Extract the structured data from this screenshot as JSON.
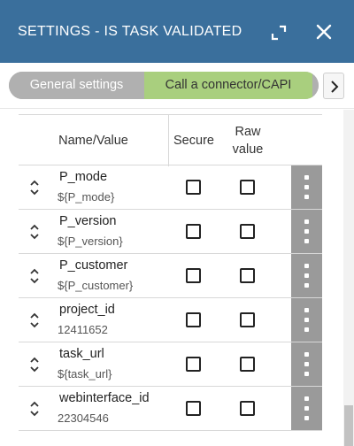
{
  "header": {
    "title": "SETTINGS  - IS TASK VALIDATED",
    "background": "#3a6f9c",
    "expand_icon": "expand-icon",
    "close_icon": "close-icon"
  },
  "tabs": {
    "items": [
      {
        "label": "General settings",
        "active": false
      },
      {
        "label": "Call a connector/CAPI",
        "active": true
      }
    ],
    "next_icon": "chevron-right-icon",
    "active_color": "#a9cf7e",
    "inactive_color": "#b0b0b0"
  },
  "table": {
    "headers": {
      "name_value": "Name/Value",
      "secure": "Secure",
      "raw_value": "Raw\nvalue"
    },
    "rows": [
      {
        "name": "P_mode",
        "value": "${P_mode}",
        "secure": false,
        "raw": false
      },
      {
        "name": "P_version",
        "value": "${P_version}",
        "secure": false,
        "raw": false
      },
      {
        "name": "P_customer",
        "value": "${P_customer}",
        "secure": false,
        "raw": false
      },
      {
        "name": "project_id",
        "value": "12411652",
        "secure": false,
        "raw": false
      },
      {
        "name": "task_url",
        "value": "${task_url}",
        "secure": false,
        "raw": false
      },
      {
        "name": "webinterface_id",
        "value": "22304546",
        "secure": false,
        "raw": false
      }
    ],
    "row_icons": {
      "drag": "drag-handle-icon",
      "menu": "more-vertical-icon"
    }
  }
}
